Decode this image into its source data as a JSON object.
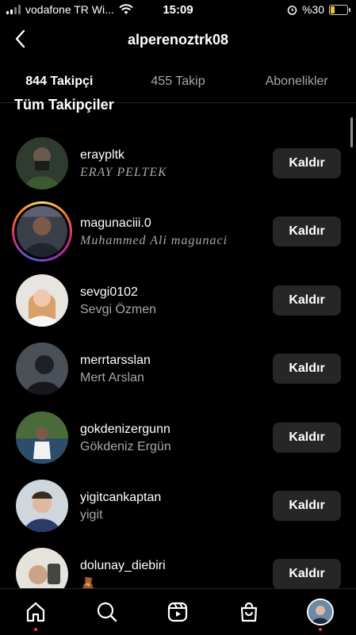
{
  "status_bar": {
    "carrier": "vodafone TR Wi...",
    "time": "15:09",
    "battery_text": "%30",
    "battery_level": 0.3,
    "battery_color": "#f2c230"
  },
  "header": {
    "title": "alperenoztrk08",
    "back_icon": "chevron-left-icon"
  },
  "tabs": [
    {
      "label": "844 Takipçi",
      "active": true
    },
    {
      "label": "455 Takip",
      "active": false
    },
    {
      "label": "Abonelikler",
      "active": false
    }
  ],
  "section_title": "Tüm Takipçiler",
  "followers": [
    {
      "username": "erayp​ltk",
      "full_name": "ERAY PELTEK",
      "story_ring": false,
      "button": "Kaldır"
    },
    {
      "username": "magunaciii.0",
      "full_name": "Muhammed Ali magunaci",
      "story_ring": true,
      "button": "Kaldır"
    },
    {
      "username": "sevgi0102",
      "full_name": "Sevgi Özmen",
      "story_ring": false,
      "button": "Kaldır"
    },
    {
      "username": "merrtarsslan",
      "full_name": "Mert Arslan",
      "story_ring": false,
      "button": "Kaldır"
    },
    {
      "username": "gokdenizergunn",
      "full_name": "Gökdeniz Ergün",
      "story_ring": false,
      "button": "Kaldır"
    },
    {
      "username": "yigitcankaptan",
      "full_name": "yigit",
      "story_ring": false,
      "button": "Kaldır"
    },
    {
      "username": "dolunay_diebiri",
      "full_name": "🧸",
      "story_ring": false,
      "button": "Kaldır"
    }
  ],
  "bottom_nav": [
    {
      "icon": "home-icon",
      "badge": true
    },
    {
      "icon": "search-icon",
      "badge": false
    },
    {
      "icon": "reels-icon",
      "badge": false
    },
    {
      "icon": "shop-icon",
      "badge": false
    },
    {
      "icon": "profile-avatar",
      "badge": true
    }
  ],
  "colors": {
    "background": "#000000",
    "button_bg": "#262626",
    "secondary_text": "#a8a8a8",
    "badge": "#ff3040"
  }
}
